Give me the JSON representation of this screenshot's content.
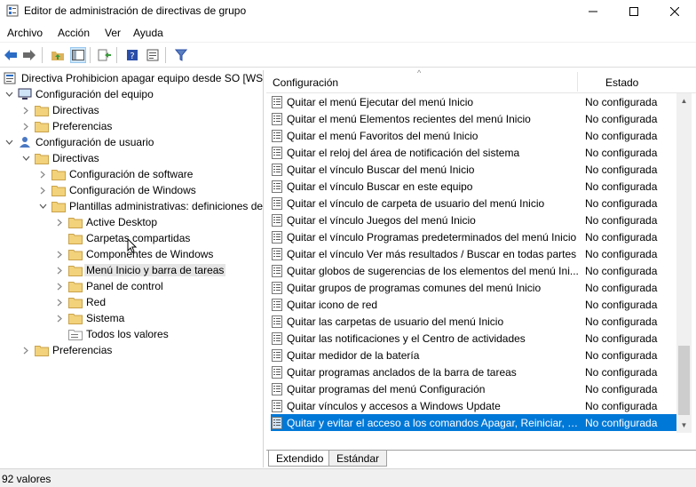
{
  "window": {
    "title": "Editor de administración de directivas de grupo"
  },
  "menu": [
    "Archivo",
    "Acción",
    "Ver",
    "Ayuda"
  ],
  "tree": [
    {
      "label": "Directiva Prohibicion apagar equipo desde SO [WSE",
      "indent": 0,
      "chevron": "",
      "icon": "policy"
    },
    {
      "label": "Configuración del equipo",
      "indent": 1,
      "chevron": "down",
      "icon": "computer"
    },
    {
      "label": "Directivas",
      "indent": 2,
      "chevron": "right",
      "icon": "folder"
    },
    {
      "label": "Preferencias",
      "indent": 2,
      "chevron": "right",
      "icon": "folder"
    },
    {
      "label": "Configuración de usuario",
      "indent": 1,
      "chevron": "down",
      "icon": "user"
    },
    {
      "label": "Directivas",
      "indent": 2,
      "chevron": "down",
      "icon": "folder"
    },
    {
      "label": "Configuración de software",
      "indent": 3,
      "chevron": "right",
      "icon": "folder"
    },
    {
      "label": "Configuración de Windows",
      "indent": 3,
      "chevron": "right",
      "icon": "folder"
    },
    {
      "label": "Plantillas administrativas: definiciones de",
      "indent": 3,
      "chevron": "down",
      "icon": "folder"
    },
    {
      "label": "Active Desktop",
      "indent": 4,
      "chevron": "right",
      "icon": "folder"
    },
    {
      "label": "Carpetas compartidas",
      "indent": 4,
      "chevron": "",
      "icon": "folder"
    },
    {
      "label": "Componentes de Windows",
      "indent": 4,
      "chevron": "right",
      "icon": "folder"
    },
    {
      "label": "Menú Inicio y barra de tareas",
      "indent": 4,
      "chevron": "right",
      "icon": "folder",
      "selected": true
    },
    {
      "label": "Panel de control",
      "indent": 4,
      "chevron": "right",
      "icon": "folder"
    },
    {
      "label": "Red",
      "indent": 4,
      "chevron": "right",
      "icon": "folder"
    },
    {
      "label": "Sistema",
      "indent": 4,
      "chevron": "right",
      "icon": "folder"
    },
    {
      "label": "Todos los valores",
      "indent": 4,
      "chevron": "",
      "icon": "allsettings"
    },
    {
      "label": "Preferencias",
      "indent": 2,
      "chevron": "right",
      "icon": "folder"
    }
  ],
  "list": {
    "col_setting": "Configuración",
    "col_state": "Estado",
    "rows": [
      {
        "name": "Quitar el menú Ejecutar del menú Inicio",
        "state": "No configurada"
      },
      {
        "name": "Quitar el menú Elementos recientes del menú Inicio",
        "state": "No configurada"
      },
      {
        "name": "Quitar el menú Favoritos del menú Inicio",
        "state": "No configurada"
      },
      {
        "name": "Quitar el reloj del área de notificación del sistema",
        "state": "No configurada"
      },
      {
        "name": "Quitar el vínculo Buscar del menú Inicio",
        "state": "No configurada"
      },
      {
        "name": "Quitar el vínculo Buscar en este equipo",
        "state": "No configurada"
      },
      {
        "name": "Quitar el vínculo de carpeta de usuario del menú Inicio",
        "state": "No configurada"
      },
      {
        "name": "Quitar el vínculo Juegos del menú Inicio",
        "state": "No configurada"
      },
      {
        "name": "Quitar el vínculo Programas predeterminados del menú Inicio",
        "state": "No configurada"
      },
      {
        "name": "Quitar el vínculo Ver más resultados / Buscar en todas partes",
        "state": "No configurada"
      },
      {
        "name": "Quitar globos de sugerencias de los elementos del menú Ini...",
        "state": "No configurada"
      },
      {
        "name": "Quitar grupos de programas comunes del menú Inicio",
        "state": "No configurada"
      },
      {
        "name": "Quitar icono de red",
        "state": "No configurada"
      },
      {
        "name": "Quitar las carpetas de usuario del menú Inicio",
        "state": "No configurada"
      },
      {
        "name": "Quitar las notificaciones y el Centro de actividades",
        "state": "No configurada"
      },
      {
        "name": "Quitar medidor de la batería",
        "state": "No configurada"
      },
      {
        "name": "Quitar programas anclados de la barra de tareas",
        "state": "No configurada"
      },
      {
        "name": "Quitar programas del menú Configuración",
        "state": "No configurada"
      },
      {
        "name": "Quitar vínculos y accesos a Windows Update",
        "state": "No configurada"
      },
      {
        "name": "Quitar y evitar el acceso a los comandos Apagar, Reiniciar, S...",
        "state": "No configurada",
        "selected": true
      }
    ]
  },
  "tabs": [
    "Extendido",
    "Estándar"
  ],
  "status": {
    "text": "92 valores"
  },
  "colors": {
    "selection": "#0078d7",
    "folder": "#dcb35c",
    "toolbar_blue": "#2b6cc4",
    "toolbar_green": "#3a9a3a"
  }
}
